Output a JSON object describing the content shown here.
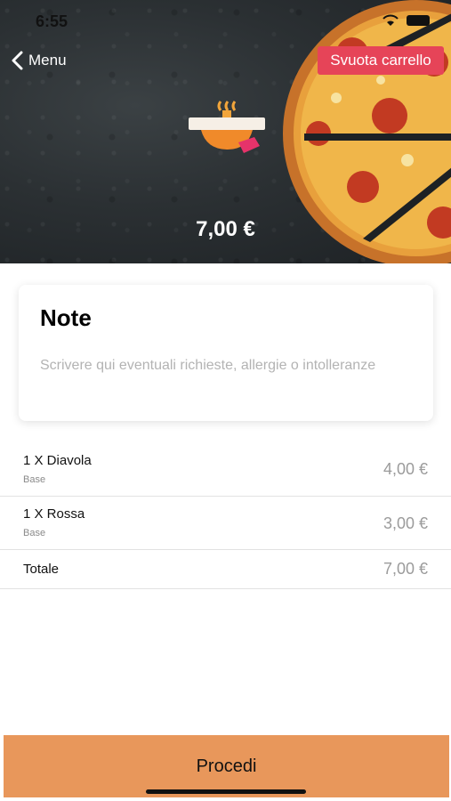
{
  "status_bar": {
    "time": "6:55"
  },
  "header": {
    "back_label": "Menu",
    "clear_cart_label": "Svuota carrello",
    "total": "7,00 €"
  },
  "note": {
    "title": "Note",
    "placeholder": "Scrivere qui eventuali richieste, allergie o intolleranze"
  },
  "items": [
    {
      "name": "1 X Diavola",
      "variant": "Base",
      "price": "4,00 €"
    },
    {
      "name": "1 X Rossa",
      "variant": "Base",
      "price": "3,00 €"
    }
  ],
  "summary": {
    "label": "Totale",
    "price": "7,00 €"
  },
  "footer": {
    "proceed_label": "Procedi"
  },
  "colors": {
    "accent_button": "#e8975b",
    "clear_cart": "#e64458"
  },
  "icons": [
    "chevron-left-icon",
    "wifi-icon",
    "battery-icon",
    "delivery-box-icon"
  ]
}
